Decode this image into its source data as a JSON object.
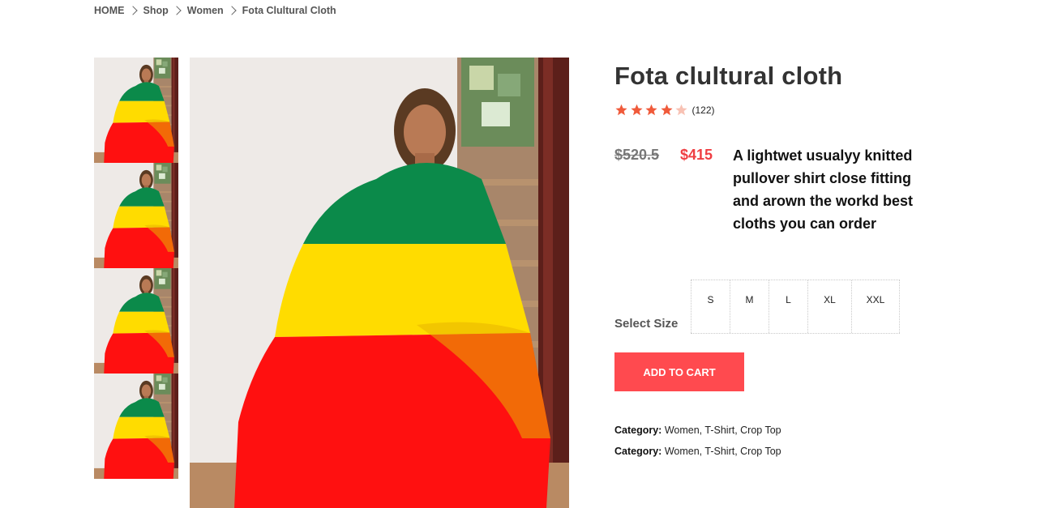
{
  "breadcrumb": {
    "home": "HOME",
    "shop": "Shop",
    "women": "Women",
    "current": "Fota Clultural Cloth"
  },
  "product": {
    "title": "Fota clultural cloth",
    "rating_value": 4,
    "rating_max": 5,
    "rating_count": "(122)",
    "old_price": "$520.5",
    "new_price": "$415",
    "description": "A lightwet usualyy knitted pullover shirt close fitting and arown the workd best cloths you can order",
    "size_label": "Select Size",
    "sizes": [
      "S",
      "M",
      "L",
      "XL",
      "XXL"
    ],
    "add_to_cart": "ADD TO CART",
    "categories": [
      {
        "label": "Category:",
        "value": "Women, T-Shirt, Crop Top"
      },
      {
        "label": "Category:",
        "value": "Women, T-Shirt, Crop Top"
      }
    ]
  },
  "colors": {
    "accent": "#ff4a4f",
    "sale_price": "#ef3e42",
    "star": "#f05a3a",
    "star_empty": "#f8c2b4",
    "flag_green": "#0b8a4a",
    "flag_yellow": "#ffdc00",
    "flag_red": "#ff1010"
  }
}
